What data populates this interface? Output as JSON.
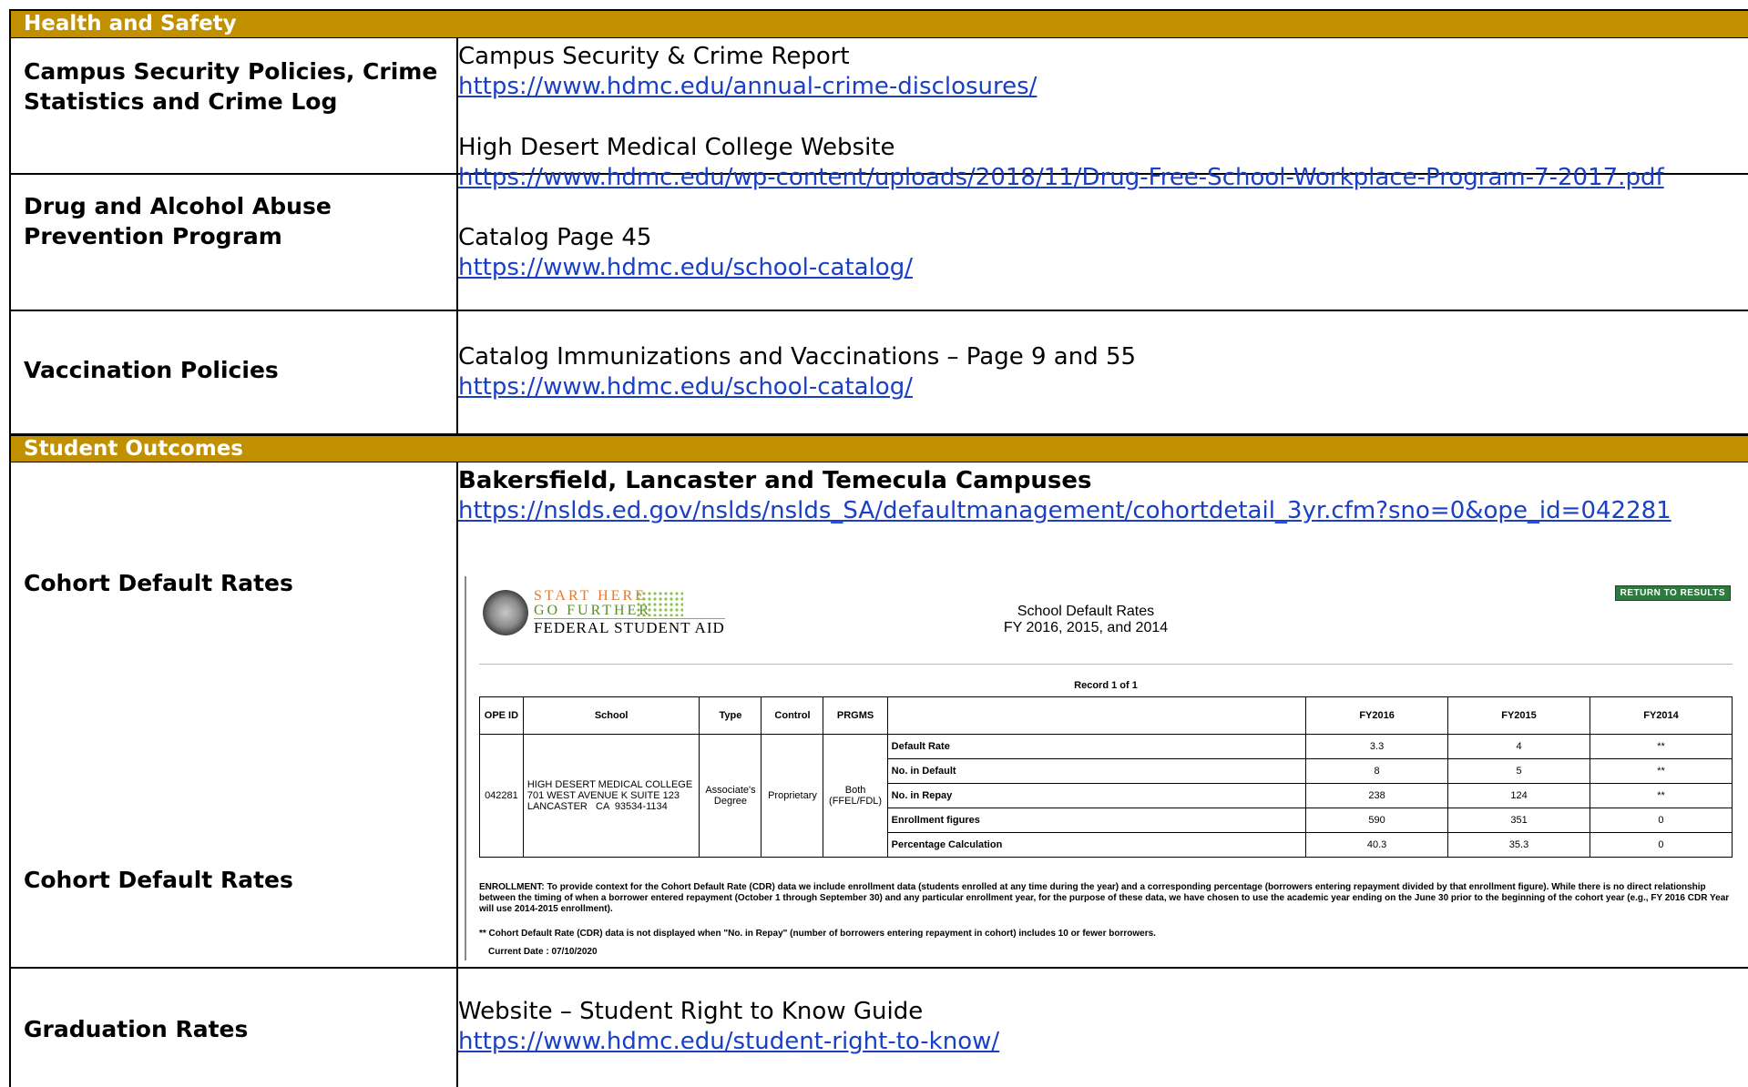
{
  "sections": {
    "health_safety": "Health and Safety",
    "student_outcomes": "Student Outcomes"
  },
  "rows": {
    "campus_security": {
      "label": "Campus Security Policies, Crime Statistics and Crime Log",
      "line1": "Campus Security & Crime Report",
      "link1": "https://www.hdmc.edu/annual-crime-disclosures/"
    },
    "drug_alcohol": {
      "label": "Drug and Alcohol Abuse Prevention Program",
      "line1": "High Desert Medical College Website",
      "link1": "https://www.hdmc.edu/wp-content/uploads/2018/11/Drug-Free-School-Workplace-Program-7-2017.pdf",
      "line2": "Catalog Page 45",
      "link2": "https://www.hdmc.edu/school-catalog/"
    },
    "vaccination": {
      "label": "Vaccination Policies",
      "line1": "Catalog Immunizations and Vaccinations – Page 9 and 55",
      "link1": "https://www.hdmc.edu/school-catalog/"
    },
    "cohort": {
      "label": "Cohort Default Rates",
      "label2": "Cohort Default Rates",
      "heading": "Bakersfield, Lancaster and Temecula Campuses",
      "link1": "https://nslds.ed.gov/nslds/nslds_SA/defaultmanagement/cohortdetail_3yr.cfm?sno=0&ope_id=042281"
    },
    "graduation": {
      "label": "Graduation Rates",
      "line1": "Website – Student Right to Know Guide",
      "link1": "https://www.hdmc.edu/student-right-to-know/"
    }
  },
  "fsa": {
    "logo_line1": "START HERE",
    "logo_line2": "GO FURTHER",
    "logo_line3": "FEDERAL STUDENT AID",
    "return_button": "RETURN TO RESULTS",
    "title_line1": "School Default Rates",
    "title_line2": "FY 2016, 2015, and 2014",
    "record": "Record 1 of 1",
    "headers": {
      "ope_id": "OPE ID",
      "school": "School",
      "type": "Type",
      "control": "Control",
      "prgms": "PRGMS",
      "fy2016": "FY2016",
      "fy2015": "FY2015",
      "fy2014": "FY2014"
    },
    "ope_id": "042281",
    "school_name": "HIGH DESERT MEDICAL COLLEGE",
    "school_address": "701 WEST AVENUE K SUITE 123",
    "school_city": "LANCASTER   CA  93534-1134",
    "type": "Associate's Degree",
    "control": "Proprietary",
    "prgms": "Both (FFEL/FDL)",
    "metrics": [
      {
        "label": "Default Rate",
        "fy2016": "3.3",
        "fy2015": "4",
        "fy2014": "**"
      },
      {
        "label": "No. in Default",
        "fy2016": "8",
        "fy2015": "5",
        "fy2014": "**"
      },
      {
        "label": "No. in Repay",
        "fy2016": "238",
        "fy2015": "124",
        "fy2014": "**"
      },
      {
        "label": "Enrollment figures",
        "fy2016": "590",
        "fy2015": "351",
        "fy2014": "0"
      },
      {
        "label": "Percentage Calculation",
        "fy2016": "40.3",
        "fy2015": "35.3",
        "fy2014": "0"
      }
    ],
    "enrollment_note": "ENROLLMENT: To provide context for the Cohort Default Rate (CDR) data we include enrollment data (students enrolled at any time during the year) and a corresponding percentage (borrowers entering repayment divided by that enrollment figure). While there is no direct relationship between the timing of when a borrower entered repayment (October 1 through September 30) and any particular enrollment year, for the purpose of these data, we have chosen to use the academic year ending on the June 30 prior to the beginning of the cohort year (e.g., FY 2016 CDR Year will use 2014-2015 enrollment).",
    "cdr_note": "** Cohort Default Rate (CDR) data is not displayed when \"No. in Repay\" (number of borrowers entering repayment in cohort) includes 10 or fewer borrowers.",
    "current_date": "Current Date :   07/10/2020"
  }
}
